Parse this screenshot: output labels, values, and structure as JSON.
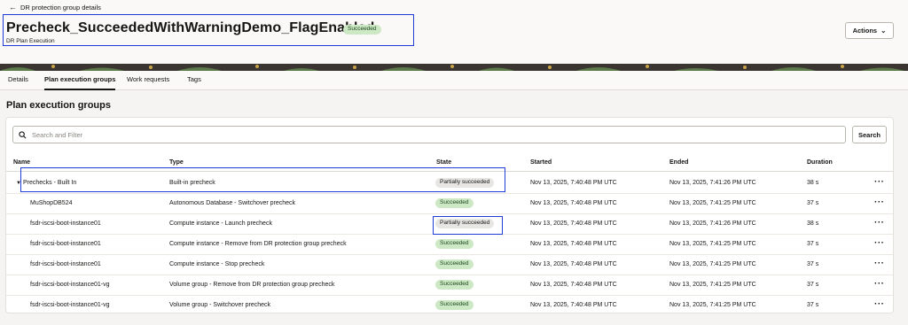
{
  "header": {
    "back_label": "DR protection group details",
    "title": "Precheck_SucceededWithWarningDemo_FlagEnabled",
    "status": "Succeeded",
    "subtitle": "DR Plan Execution",
    "actions_label": "Actions"
  },
  "tabs": [
    {
      "label": "Details",
      "active": false
    },
    {
      "label": "Plan execution groups",
      "active": true
    },
    {
      "label": "Work requests",
      "active": false
    },
    {
      "label": "Tags",
      "active": false
    }
  ],
  "section_title": "Plan execution groups",
  "search": {
    "placeholder": "Search and Filter",
    "button_label": "Search"
  },
  "columns": {
    "name": "Name",
    "type": "Type",
    "state": "State",
    "started": "Started",
    "ended": "Ended",
    "duration": "Duration"
  },
  "rows": [
    {
      "name": "Prechecks - Built In",
      "type": "Built-in precheck",
      "state": "Partially succeeded",
      "started": "Nov 13, 2025, 7:40:48 PM UTC",
      "ended": "Nov 13, 2025, 7:41:26 PM UTC",
      "duration": "38 s",
      "group": true
    },
    {
      "name": "MuShopDB524",
      "type": "Autonomous Database - Switchover precheck",
      "state": "Succeeded",
      "started": "Nov 13, 2025, 7:40:48 PM UTC",
      "ended": "Nov 13, 2025, 7:41:25 PM UTC",
      "duration": "37 s"
    },
    {
      "name": "fsdr-iscsi-boot-instance01",
      "type": "Compute instance - Launch precheck",
      "state": "Partially succeeded",
      "started": "Nov 13, 2025, 7:40:48 PM UTC",
      "ended": "Nov 13, 2025, 7:41:26 PM UTC",
      "duration": "38 s"
    },
    {
      "name": "fsdr-iscsi-boot-instance01",
      "type": "Compute instance - Remove from DR protection group precheck",
      "state": "Succeeded",
      "started": "Nov 13, 2025, 7:40:48 PM UTC",
      "ended": "Nov 13, 2025, 7:41:25 PM UTC",
      "duration": "37 s"
    },
    {
      "name": "fsdr-iscsi-boot-instance01",
      "type": "Compute instance - Stop precheck",
      "state": "Succeeded",
      "started": "Nov 13, 2025, 7:40:48 PM UTC",
      "ended": "Nov 13, 2025, 7:41:25 PM UTC",
      "duration": "37 s"
    },
    {
      "name": "fsdr-iscsi-boot-instance01-vg",
      "type": "Volume group - Remove from DR protection group precheck",
      "state": "Succeeded",
      "started": "Nov 13, 2025, 7:40:48 PM UTC",
      "ended": "Nov 13, 2025, 7:41:25 PM UTC",
      "duration": "37 s"
    },
    {
      "name": "fsdr-iscsi-boot-instance01-vg",
      "type": "Volume group - Switchover precheck",
      "state": "Succeeded",
      "started": "Nov 13, 2025, 7:40:48 PM UTC",
      "ended": "Nov 13, 2025, 7:41:25 PM UTC",
      "duration": "37 s"
    }
  ],
  "icons": {
    "back": "arrow-left-icon",
    "actions_caret": "chevron-down-icon",
    "search": "search-icon",
    "row_menu": "more-horizontal-icon",
    "expand": "caret-down-icon"
  },
  "colors": {
    "succeeded_badge": "#cde8c5",
    "partial_badge": "#e8e6e3",
    "highlight": "#1f3dd6"
  }
}
